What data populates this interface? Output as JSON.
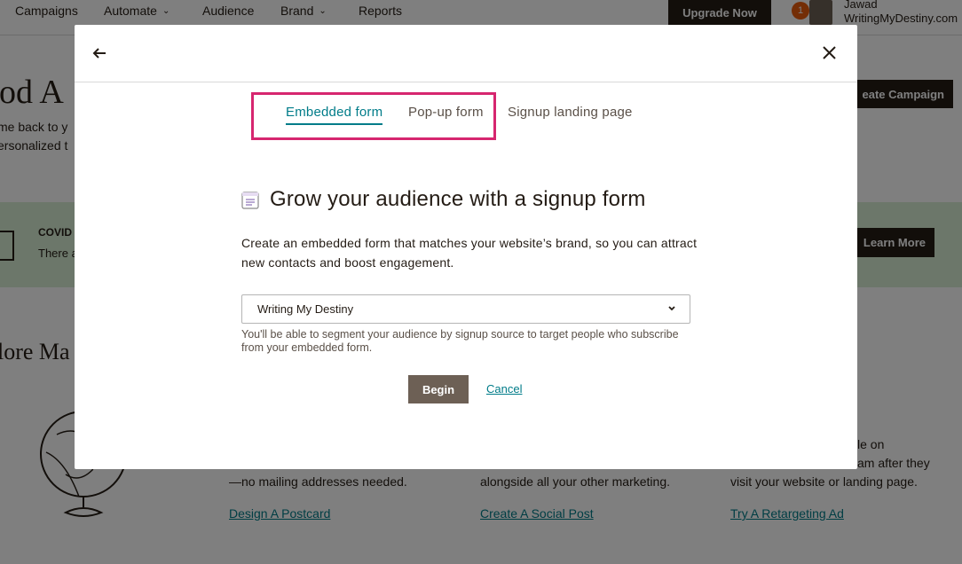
{
  "nav": {
    "items": [
      {
        "label": "Campaigns"
      },
      {
        "label": "Automate",
        "chevron": "chevron-down-icon"
      },
      {
        "label": "Audience"
      },
      {
        "label": "Brand",
        "chevron": "chevron-down-icon"
      },
      {
        "label": "Reports"
      }
    ],
    "upgrade_label": "Upgrade Now",
    "notification_count": "1",
    "user_name": "Jawad",
    "user_account": "WritingMyDestiny.com"
  },
  "background": {
    "hero_title": "ood A",
    "hero_line1": "me back to y",
    "hero_line2": "ersonalized t",
    "create_campaign_label": "eate Campaign",
    "covid_title": "COVID",
    "covid_text": "There a",
    "learn_more_label": "Learn More",
    "explore_title": "lore Ma",
    "cards": [
      {
        "line_bottom": "—no mailing addresses needed.",
        "link": "Design A Postcard"
      },
      {
        "line_bottom": "alongside all your other marketing.",
        "link": "Create A Social Post"
      },
      {
        "line_top": "le on",
        "line_mid": "am after they",
        "line_bottom": "visit your website or landing page.",
        "link": "Try A Retargeting Ad"
      }
    ]
  },
  "modal": {
    "tabs": [
      {
        "label": "Embedded form",
        "active": true
      },
      {
        "label": "Pop-up form",
        "active": false
      },
      {
        "label": "Signup landing page",
        "active": false
      }
    ],
    "heading": "Grow your audience with a signup form",
    "description": "Create an embedded form that matches your website’s brand, so you can attract new contacts and boost engagement.",
    "audience_select_value": "Writing My Destiny",
    "helper_text": "You'll be able to segment your audience by signup source to target people who subscribe from your embedded form.",
    "begin_label": "Begin",
    "cancel_label": "Cancel"
  },
  "colors": {
    "accent": "#007c89",
    "highlight": "#d6266f",
    "dark": "#241c15",
    "button_disabled": "#6d6055",
    "banner": "#d9eed5"
  }
}
